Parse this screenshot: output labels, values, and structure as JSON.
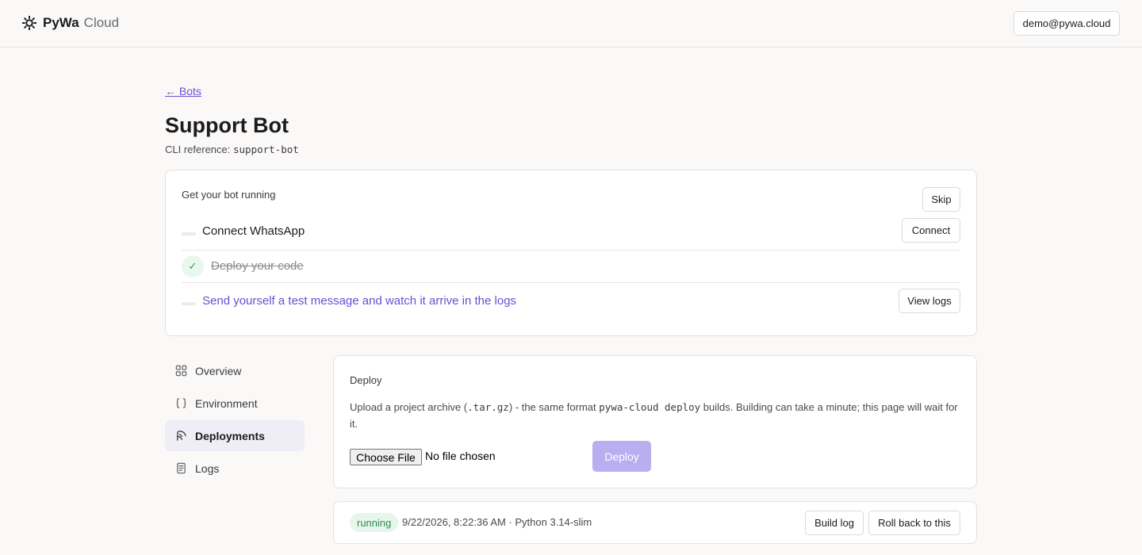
{
  "header": {
    "brand_name": "PyWa",
    "brand_sub": "Cloud",
    "user_email": "demo@pywa.cloud"
  },
  "page": {
    "back_label": "← Bots",
    "title": "Support Bot",
    "cli_label": "CLI reference:",
    "cli_value": "support-bot"
  },
  "onboarding": {
    "title": "Get your bot running",
    "skip_label": "Skip",
    "steps": [
      {
        "label": "Connect WhatsApp",
        "action": "Connect",
        "done": false
      },
      {
        "label": "Deploy your code",
        "done": true
      },
      {
        "label": "Send yourself a test message and watch it arrive in the logs",
        "action": "View logs",
        "done": false
      }
    ]
  },
  "sidebar": {
    "items": [
      {
        "label": "Overview",
        "icon": "grid-icon"
      },
      {
        "label": "Environment",
        "icon": "braces-icon"
      },
      {
        "label": "Deployments",
        "icon": "rocket-icon",
        "active": true
      },
      {
        "label": "Logs",
        "icon": "document-icon"
      }
    ]
  },
  "deploy": {
    "title": "Deploy",
    "desc_1": "Upload a project archive (",
    "desc_code_1": ".tar.gz",
    "desc_2": ") - the same format ",
    "desc_code_2": "pywa-cloud deploy",
    "desc_3": " builds. Building can take a minute; this page will wait for it.",
    "choose_file_label": "Choose File",
    "no_file_text": "No file chosen",
    "deploy_label": "Deploy"
  },
  "deployments": [
    {
      "status": "running",
      "meta": "9/22/2026, 8:22:36 AM · Python 3.14-slim",
      "build_log_label": "Build log",
      "rollback_label": "Roll back to this"
    }
  ],
  "colors": {
    "accent": "#6a4fd3",
    "running_bg": "#e6f6ec",
    "running_text": "#2e8f52",
    "deploy_disabled": "#b9aef0"
  }
}
